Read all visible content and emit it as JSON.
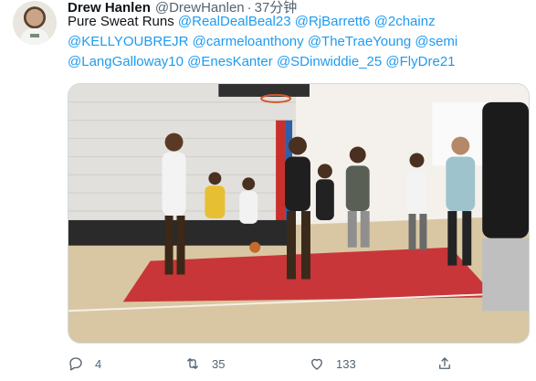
{
  "tweet": {
    "author": {
      "name": "Drew Hanlen",
      "handle": "@DrewHanlen",
      "separator": "·",
      "time": "37分钟"
    },
    "text_prefix": "Pure Sweat Runs ",
    "mentions": [
      "@RealDealBeal23",
      "@RjBarrett6",
      "@2chainz",
      "@KELLYOUBREJR",
      "@carmeloanthony",
      "@TheTraeYoung",
      "@semi",
      "@LangGalloway10",
      "@EnesKanter",
      "@SDinwiddie_25",
      "@FlyDre21"
    ],
    "media": {
      "type": "video-still",
      "description_icon": "basketball-court-image"
    },
    "actions": {
      "reply": {
        "icon": "reply-icon",
        "count": "4"
      },
      "retweet": {
        "icon": "retweet-icon",
        "count": "35"
      },
      "like": {
        "icon": "heart-icon",
        "count": "133"
      },
      "share": {
        "icon": "share-icon"
      }
    }
  },
  "colors": {
    "link": "#1d9bf0",
    "muted": "#536471",
    "court": "#c8363a",
    "floor": "#d9c7a3"
  }
}
